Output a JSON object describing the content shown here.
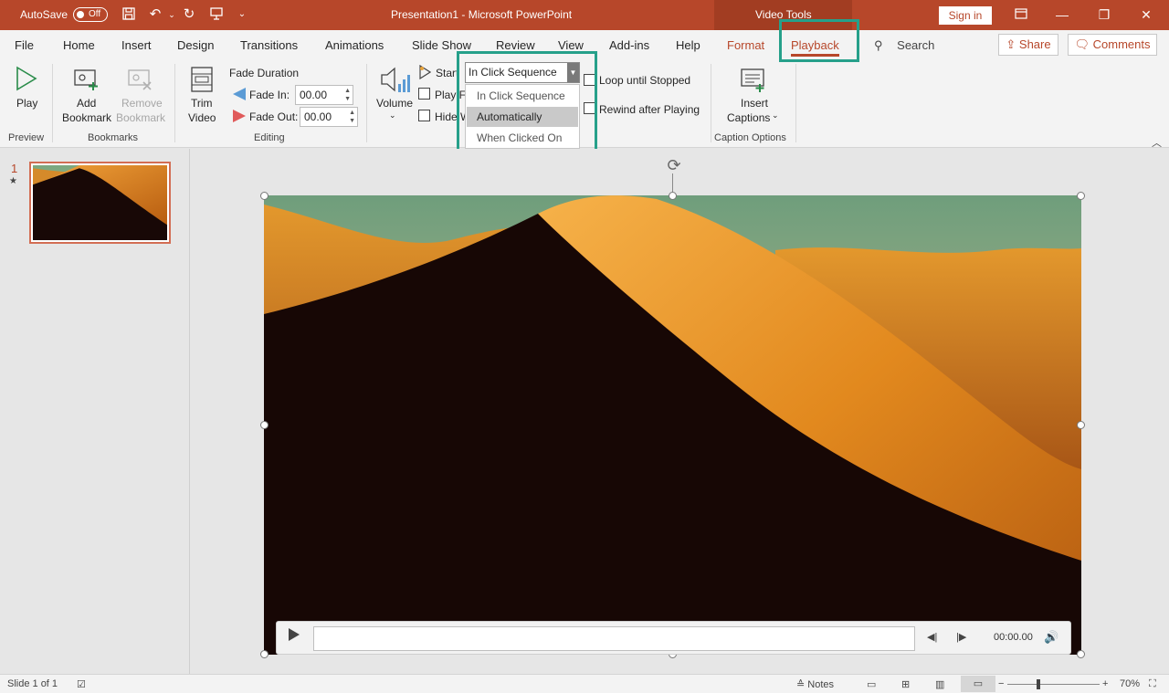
{
  "titlebar": {
    "autosave_label": "AutoSave",
    "autosave_state": "Off",
    "document_title": "Presentation1  -  Microsoft PowerPoint",
    "contextual_label": "Video Tools",
    "signin_label": "Sign in"
  },
  "tabs": {
    "file": "File",
    "home": "Home",
    "insert": "Insert",
    "design": "Design",
    "transitions": "Transitions",
    "animations": "Animations",
    "slideshow": "Slide Show",
    "review": "Review",
    "view": "View",
    "addins": "Add-ins",
    "help": "Help",
    "format": "Format",
    "playback": "Playback",
    "search": "Search",
    "share": "Share",
    "comments": "Comments"
  },
  "ribbon": {
    "play": "Play",
    "preview_group": "Preview",
    "add_bookmark_1": "Add",
    "add_bookmark_2": "Bookmark",
    "remove_bookmark_1": "Remove",
    "remove_bookmark_2": "Bookmark",
    "bookmarks_group": "Bookmarks",
    "trim_1": "Trim",
    "trim_2": "Video",
    "fade_duration": "Fade Duration",
    "fade_in_label": "Fade In:",
    "fade_in_value": "00.00",
    "fade_out_label": "Fade Out:",
    "fade_out_value": "00.00",
    "editing_group": "Editing",
    "volume": "Volume",
    "start_label": "Start",
    "start_value": "In Click Sequence",
    "play_full_label": "Play Fu",
    "hide_label": "Hide W",
    "loop_label": "Loop until Stopped",
    "rewind_label": "Rewind after Playing",
    "insert_captions_1": "Insert",
    "insert_captions_2": "Captions",
    "caption_group": "Caption Options",
    "start_options": [
      "In Click Sequence",
      "Automatically",
      "When Clicked On"
    ],
    "start_highlighted": "Automatically"
  },
  "slides_pane": {
    "slide_number": "1",
    "star": "★"
  },
  "player": {
    "time": "00:00.00"
  },
  "statusbar": {
    "slide_info": "Slide 1 of 1",
    "notes": "Notes",
    "zoom": "70%"
  },
  "colors": {
    "accent": "#b7472a",
    "highlight_box": "#26a08a"
  }
}
